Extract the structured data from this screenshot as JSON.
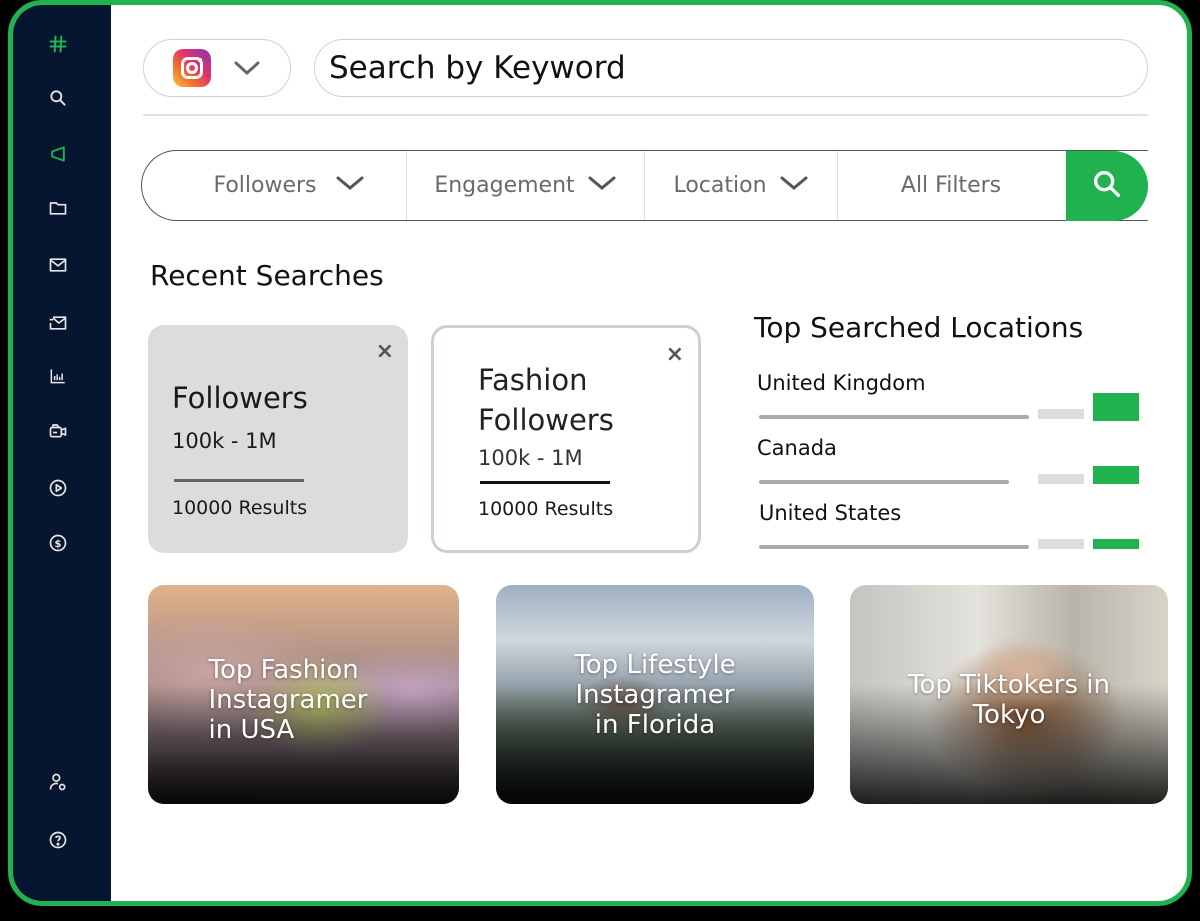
{
  "sidebar": {
    "items": [
      {
        "name": "hashtag-icon",
        "label": "Home",
        "active": true
      },
      {
        "name": "search-icon",
        "label": "Search"
      },
      {
        "name": "megaphone-icon",
        "label": "Campaigns",
        "active": true
      },
      {
        "name": "folder-icon",
        "label": "Lists"
      },
      {
        "name": "mail-icon",
        "label": "Inbox"
      },
      {
        "name": "mail-send-icon",
        "label": "Outreach"
      },
      {
        "name": "bar-chart-icon",
        "label": "Analytics"
      },
      {
        "name": "camera-icon",
        "label": "Content"
      },
      {
        "name": "play-icon",
        "label": "Media"
      },
      {
        "name": "dollar-icon",
        "label": "Payments"
      },
      {
        "name": "user-settings-icon",
        "label": "Account"
      },
      {
        "name": "help-icon",
        "label": "Help"
      }
    ],
    "accent_color": "#1fb24f",
    "background_color": "#061630"
  },
  "header": {
    "platform_selected": "Instagram",
    "keyword_search_placeholder": "Search by Keyword"
  },
  "filters": {
    "items": [
      {
        "label": "Followers",
        "has_dropdown": true
      },
      {
        "label": "Engagement",
        "has_dropdown": true
      },
      {
        "label": "Location",
        "has_dropdown": true
      },
      {
        "label": "All Filters",
        "has_dropdown": false
      }
    ],
    "search_button_color": "#1fb24f"
  },
  "recent_searches": {
    "title": "Recent Searches",
    "cards": [
      {
        "title": "Followers",
        "range": "100k - 1M",
        "results": "10000 Results",
        "close": "×"
      },
      {
        "title": "Fashion Followers",
        "range": "100k - 1M",
        "results": "10000 Results",
        "close": "×"
      }
    ]
  },
  "top_locations": {
    "title": "Top Searched Locations",
    "items": [
      {
        "name": "United Kingdom",
        "share": 0.95
      },
      {
        "name": "Canada",
        "share": 0.88
      },
      {
        "name": "United States",
        "share": 0.95
      }
    ]
  },
  "tiles": [
    {
      "title": "Top Fashion Instagramer in USA"
    },
    {
      "title": "Top Lifestyle Instagramer in Florida"
    },
    {
      "title": "Top Tiktokers in Tokyo"
    }
  ]
}
